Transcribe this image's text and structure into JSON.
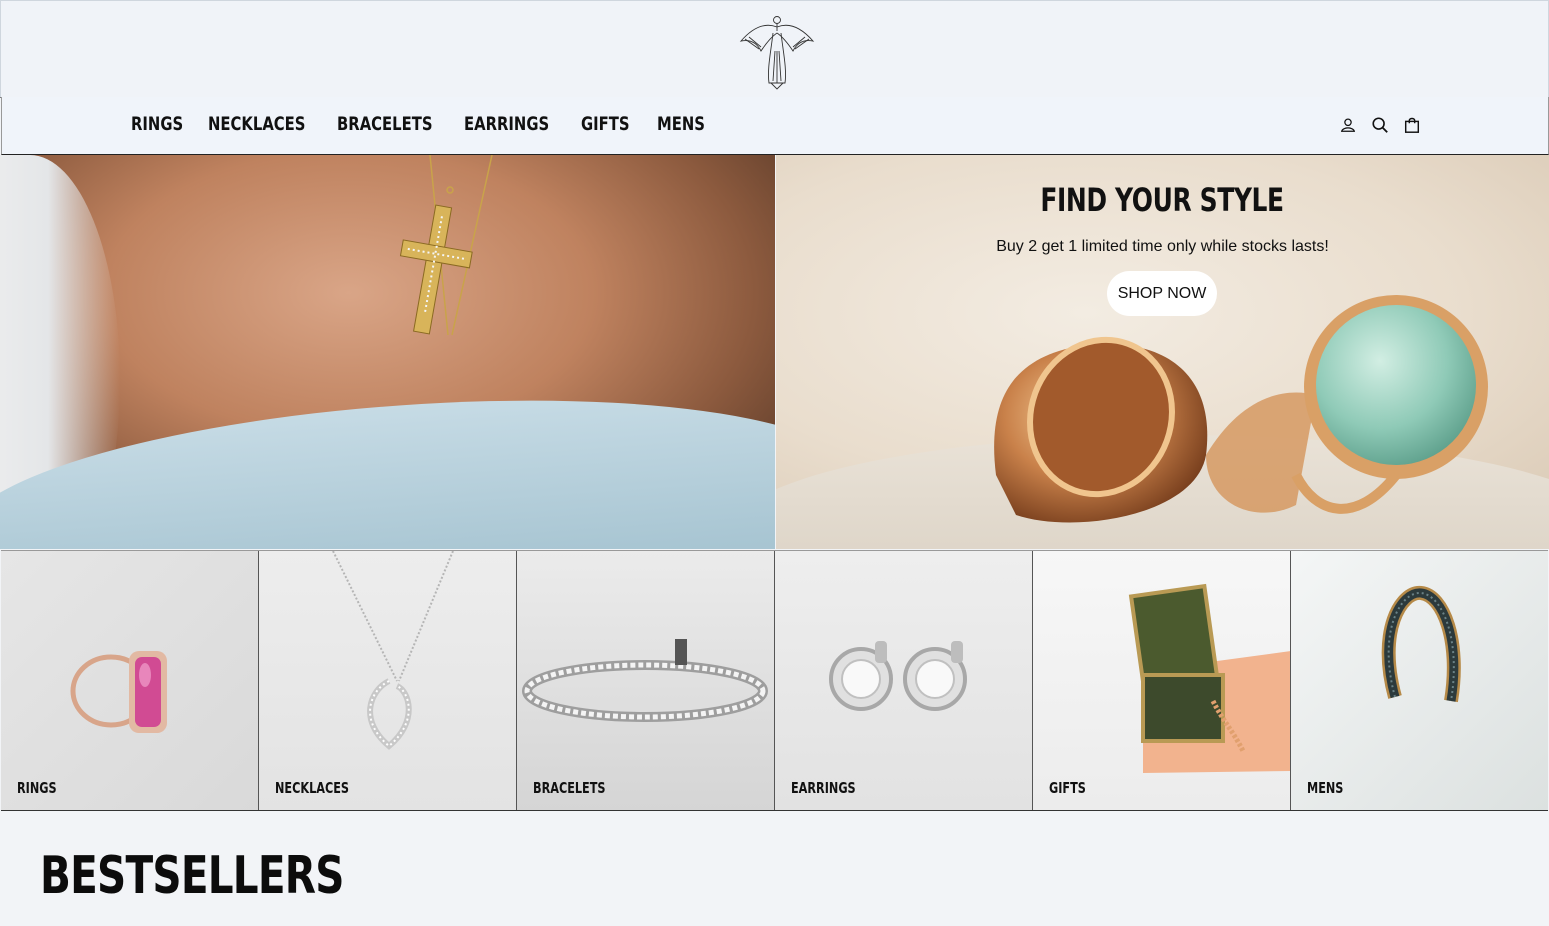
{
  "header": {
    "logo_icon": "winged-figure-logo-icon"
  },
  "nav": {
    "links": [
      {
        "label": "RINGS"
      },
      {
        "label": "NECKLACES"
      },
      {
        "label": "BRACELETS"
      },
      {
        "label": "EARRINGS"
      },
      {
        "label": "GIFTS"
      },
      {
        "label": "MENS"
      }
    ],
    "icons": [
      "account-icon",
      "search-icon",
      "cart-bag-icon"
    ]
  },
  "hero": {
    "title": "FIND YOUR STYLE",
    "subtitle": "Buy 2 get 1 limited time only while stocks lasts!",
    "cta_label": "SHOP NOW"
  },
  "categories": [
    {
      "label": "RINGS",
      "image": "pink-stone-rose-gold-ring"
    },
    {
      "label": "NECKLACES",
      "image": "diamond-heart-necklace"
    },
    {
      "label": "BRACELETS",
      "image": "diamond-tennis-bracelet"
    },
    {
      "label": "EARRINGS",
      "image": "diamond-halo-stud-earrings"
    },
    {
      "label": "GIFTS",
      "image": "jewelry-box-on-book"
    },
    {
      "label": "MENS",
      "image": "dark-cuff-bracelet"
    }
  ],
  "section": {
    "bestsellers_title": "BESTSELLERS"
  },
  "colors": {
    "background": "#f2f4f7",
    "text": "#111111",
    "button_bg": "#ffffff"
  }
}
